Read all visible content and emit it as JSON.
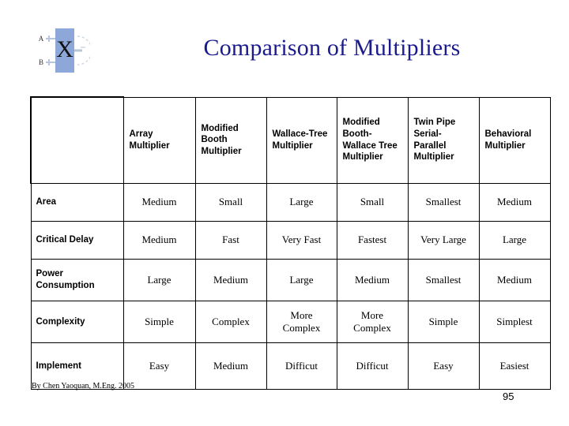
{
  "slide": {
    "title": "Comparison of Multipliers",
    "title_color": "#1b1b8f",
    "page_number": "95",
    "credit": "By Chen Yaoquan, M.Eng. 2005"
  },
  "logo": {
    "name": "multiplier-block-diagram",
    "block_label": "X",
    "input_a_label": "A",
    "input_b_label": "B",
    "block_fill": "#8ca7d8"
  },
  "table": {
    "corner_label": "",
    "columns": [
      "Array Multiplier",
      "Modified Booth Multiplier",
      "Wallace-Tree Multiplier",
      "Modified Booth-Wallace Tree Multiplier",
      "Twin Pipe Serial-Parallel Multiplier",
      "Behavioral Multiplier"
    ],
    "rows": [
      {
        "label": "Area",
        "values": [
          "Medium",
          "Small",
          "Large",
          "Small",
          "Smallest",
          "Medium"
        ]
      },
      {
        "label": "Critical Delay",
        "values": [
          "Medium",
          "Fast",
          "Very Fast",
          "Fastest",
          "Very Large",
          "Large"
        ]
      },
      {
        "label": "Power Consumption",
        "values": [
          "Large",
          "Medium",
          "Large",
          "Medium",
          "Smallest",
          "Medium"
        ]
      },
      {
        "label": "Complexity",
        "values": [
          "Simple",
          "Complex",
          "More Complex",
          "More Complex",
          "Simple",
          "Simplest"
        ]
      },
      {
        "label": "Implement",
        "values": [
          "Easy",
          "Medium",
          "Difficut",
          "Difficut",
          "Easy",
          "Easiest"
        ]
      }
    ]
  }
}
